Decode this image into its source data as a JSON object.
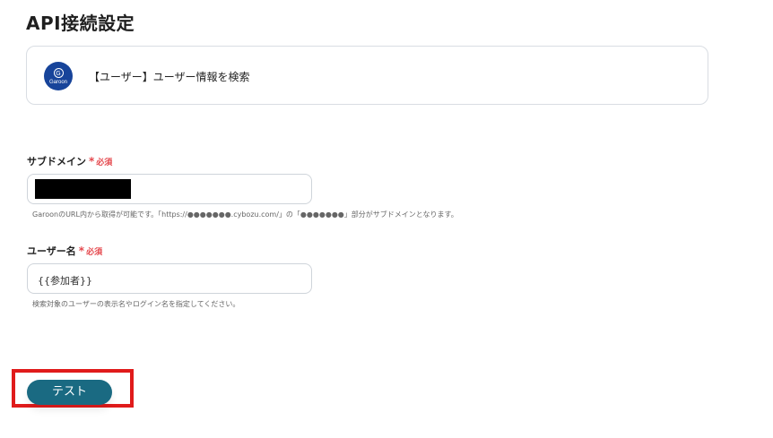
{
  "page": {
    "title": "API接続設定"
  },
  "action": {
    "app_logo_letter": "G",
    "app_logo_word": "Garoon",
    "label": "【ユーザー】ユーザー情報を検索"
  },
  "fields": [
    {
      "label": "サブドメイン",
      "required_star": "*",
      "required_text": "必須",
      "value": "",
      "value_masked": true,
      "hint": "GaroonのURL内から取得が可能です。「https://●●●●●●●.cybozu.com/」の「●●●●●●●」部分がサブドメインとなります。"
    },
    {
      "label": "ユーザー名",
      "required_star": "*",
      "required_text": "必須",
      "value": "{{参加者}}",
      "hint": "検索対象のユーザーの表示名やログイン名を指定してください。"
    }
  ],
  "buttons": {
    "test_label": "テスト"
  },
  "colors": {
    "accent": "#1a6a82",
    "required": "#e5484d",
    "highlight": "#e01b1b",
    "logo_bg": "#17449a"
  }
}
